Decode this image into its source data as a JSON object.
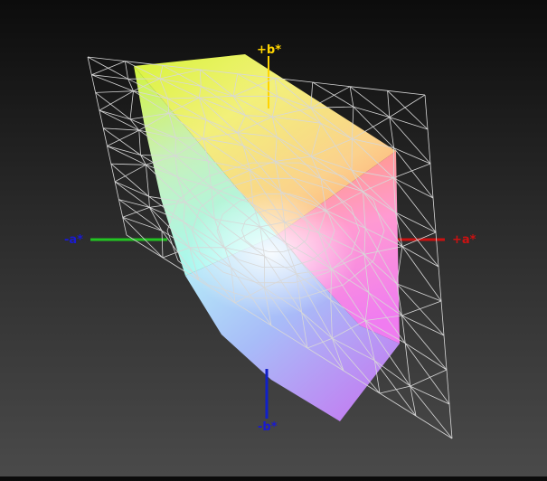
{
  "axes": {
    "plus_b": "+b*",
    "minus_a": "-a*",
    "plus_a": "+a*",
    "minus_b": "-b*"
  },
  "colors": {
    "plus_b_axis": "#ffd400",
    "minus_a_axis": "#22c422",
    "plus_a_axis": "#cc1111",
    "minus_b_axis": "#1020c8",
    "label_blue": "#1a1ad0",
    "wireframe": "#d8d8d8"
  }
}
